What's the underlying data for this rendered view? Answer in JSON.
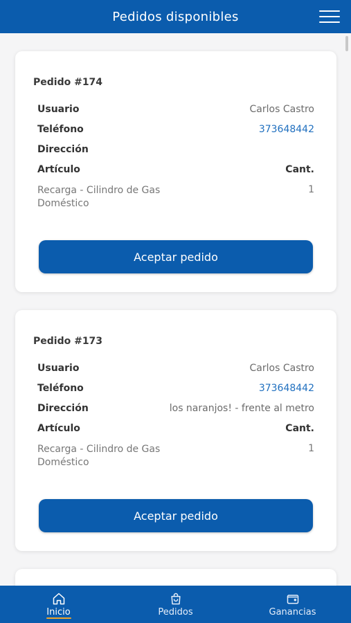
{
  "header": {
    "title": "Pedidos disponibles",
    "menu_icon": "hamburger-menu-icon"
  },
  "orders": [
    {
      "title": "Pedido #174",
      "user_label": "Usuario",
      "user": "Carlos Castro",
      "phone_label": "Teléfono",
      "phone": "373648442",
      "address_label": "Dirección",
      "address": "",
      "item_label": "Artículo",
      "qty_label": "Cant.",
      "item_name": "Recarga - Cilindro de Gas Doméstico",
      "item_qty": "1",
      "accept_label": "Aceptar pedido"
    },
    {
      "title": "Pedido #173",
      "user_label": "Usuario",
      "user": "Carlos Castro",
      "phone_label": "Teléfono",
      "phone": "373648442",
      "address_label": "Dirección",
      "address": "los naranjos! - frente al metro",
      "item_label": "Artículo",
      "qty_label": "Cant.",
      "item_name": "Recarga - Cilindro de Gas Doméstico",
      "item_qty": "1",
      "accept_label": "Aceptar pedido"
    }
  ],
  "nav": {
    "items": [
      {
        "label": "Inicio",
        "icon": "home-icon",
        "active": true
      },
      {
        "label": "Pedidos",
        "icon": "shopping-bag-icon",
        "active": false
      },
      {
        "label": "Ganancias",
        "icon": "wallet-icon",
        "active": false
      }
    ]
  },
  "colors": {
    "primary": "#0b5cad",
    "phone_link": "#1f6fbf",
    "nav_active_underline": "#f0a52a"
  }
}
